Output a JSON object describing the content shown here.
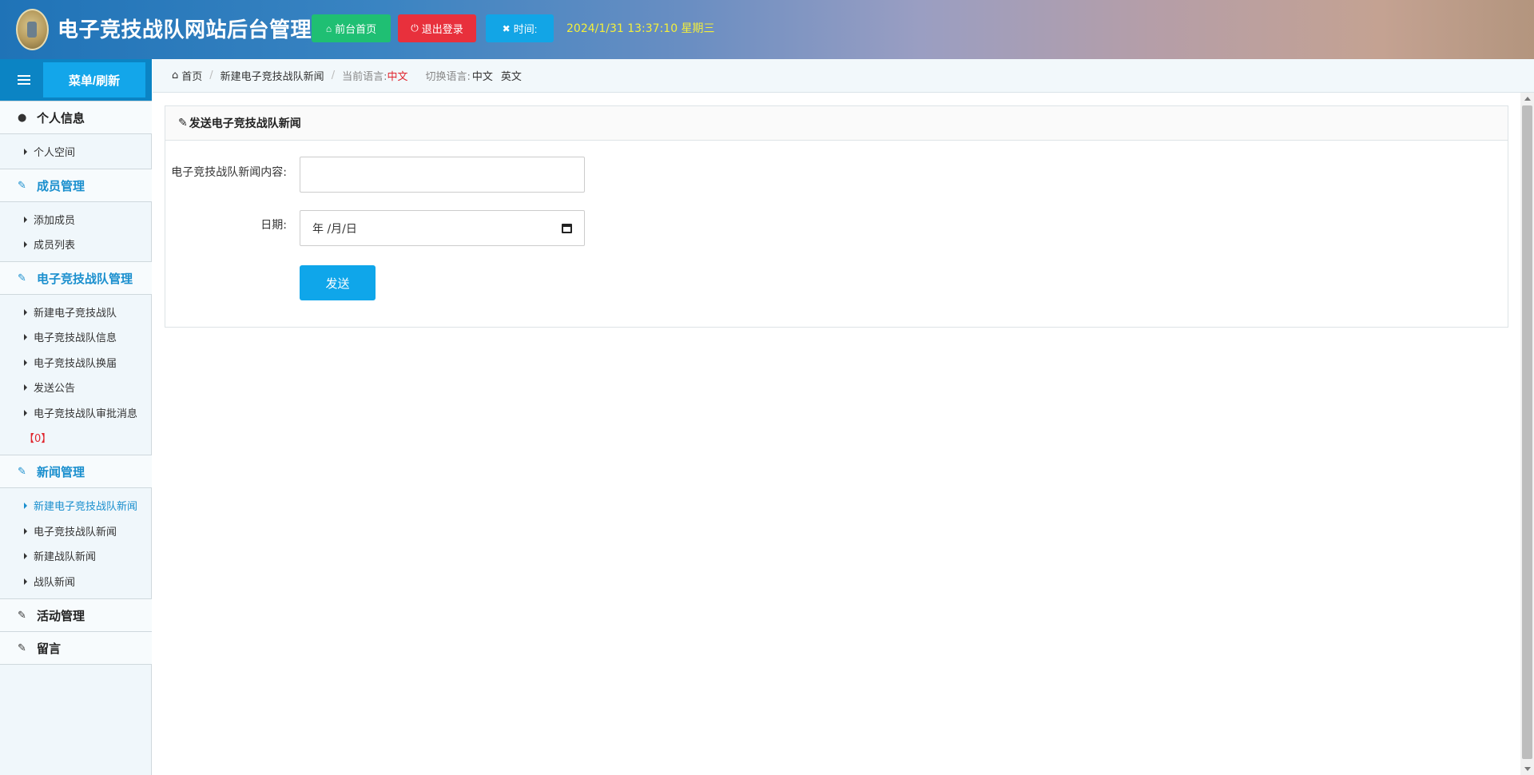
{
  "header": {
    "title": "电子竞技战队网站后台管理",
    "home_button": "前台首页",
    "logout_button": "退出登录",
    "time_button": "时间:",
    "datetime": "2024/1/31 13:37:10 星期三"
  },
  "sidebar": {
    "menu_refresh": "菜单/刷新",
    "sections": [
      {
        "label": "个人信息",
        "items": [
          "个人空间"
        ]
      },
      {
        "label": "成员管理",
        "items": [
          "添加成员",
          "成员列表"
        ]
      },
      {
        "label": "电子竞技战队管理",
        "items": [
          "新建电子竞技战队",
          "电子竞技战队信息",
          "电子竞技战队换届",
          "发送公告",
          "电子竞技战队审批消息"
        ],
        "badge": "【0】"
      },
      {
        "label": "新闻管理",
        "items": [
          "新建电子竞技战队新闻",
          "电子竞技战队新闻",
          "新建战队新闻",
          "战队新闻"
        ]
      },
      {
        "label": "活动管理",
        "items": []
      },
      {
        "label": "留言",
        "items": []
      }
    ]
  },
  "breadcrumb": {
    "home": "首页",
    "current": "新建电子竞技战队新闻",
    "current_lang_label": "当前语言:",
    "current_lang": "中文",
    "switch_label": "切换语言:",
    "lang_zh": "中文",
    "lang_en": "英文"
  },
  "form": {
    "panel_title": "发送电子竞技战队新闻",
    "content_label": "电子竞技战队新闻内容:",
    "content_value": "",
    "date_label": "日期:",
    "date_placeholder": "年 /月/日",
    "submit": "发送"
  },
  "colors": {
    "accent": "#13a6ea",
    "home_green": "#1fbf73",
    "logout_red": "#e8303c",
    "datetime_yellow": "#f4ef3a",
    "active_blue": "#1a8fce"
  }
}
